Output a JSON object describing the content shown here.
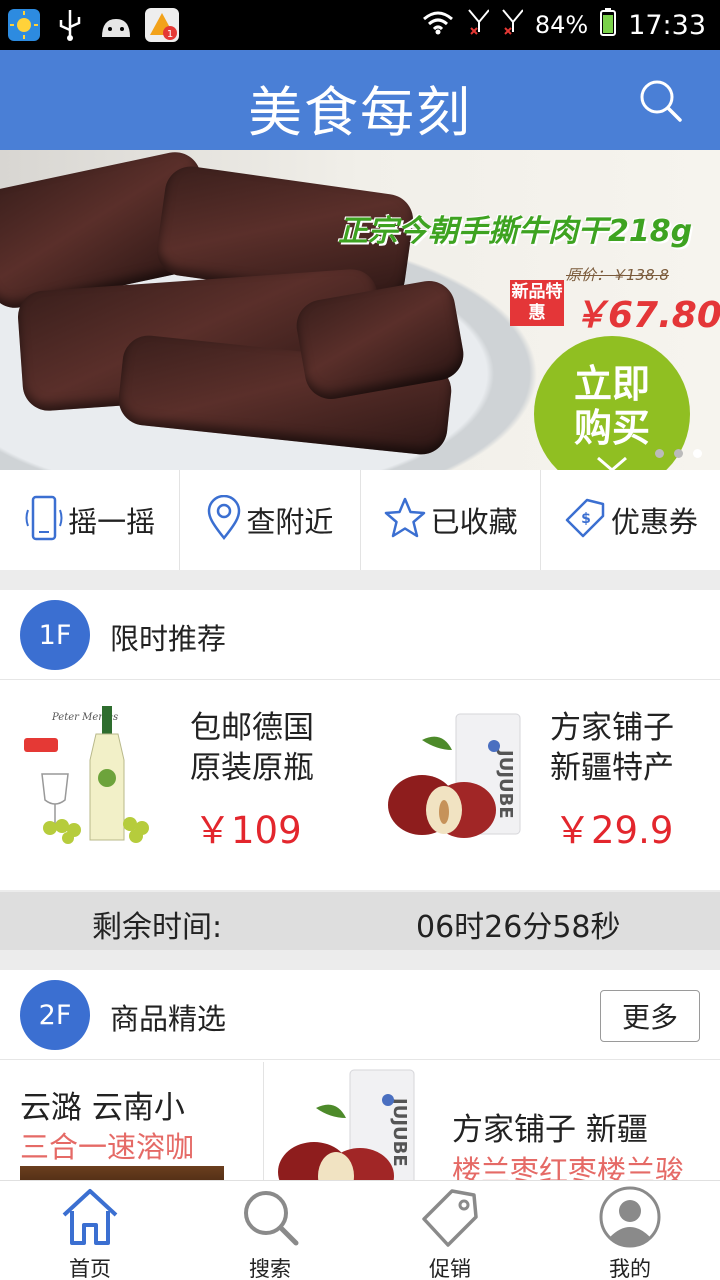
{
  "status_bar": {
    "battery": "84%",
    "time": "17:33"
  },
  "app_bar": {
    "title": "美食每刻"
  },
  "banner": {
    "headline": "正宗今朝手撕牛肉干218g",
    "original_price": "原价：￥138.8",
    "tag": "新品特惠",
    "price": "￥67.80",
    "cta": "立即购买"
  },
  "quick_menu": [
    {
      "label": "摇一摇",
      "icon": "phone-shake-icon"
    },
    {
      "label": "查附近",
      "icon": "location-pin-icon"
    },
    {
      "label": "已收藏",
      "icon": "star-icon"
    },
    {
      "label": "优惠券",
      "icon": "coupon-icon"
    }
  ],
  "section1": {
    "floor": "1F",
    "title": "限时推荐",
    "products": [
      {
        "name_line1": "包邮德国",
        "name_line2": "原装原瓶",
        "price": "￥109"
      },
      {
        "name_line1": "方家铺子",
        "name_line2": "新疆特产",
        "price": "￥29.9"
      }
    ]
  },
  "countdown": {
    "label": "剩余时间:",
    "value": "06时26分58秒"
  },
  "section2": {
    "floor": "2F",
    "title": "商品精选",
    "more": "更多",
    "left": {
      "title": "云潞 云南小",
      "subtitle": "三合一速溶咖"
    },
    "right": {
      "title": "方家铺子 新疆",
      "subtitle": "楼兰枣红枣楼兰骏"
    }
  },
  "bottom_nav": [
    {
      "label": "首页",
      "icon": "home-icon",
      "active": true
    },
    {
      "label": "搜索",
      "icon": "search-icon",
      "active": false
    },
    {
      "label": "促销",
      "icon": "tag-icon",
      "active": false
    },
    {
      "label": "我的",
      "icon": "user-avatar-icon",
      "active": false
    }
  ],
  "colors": {
    "primary": "#4a7fd6",
    "floor_badge": "#3b6fd1",
    "price_red": "#e3262d",
    "accent_green": "#90bf22"
  }
}
